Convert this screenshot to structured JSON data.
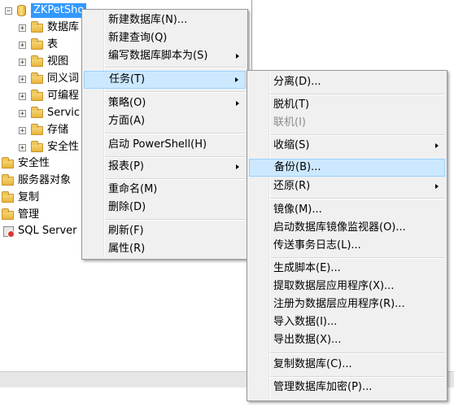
{
  "tree": {
    "root_label": "ZKPetSho",
    "children": [
      "数据库",
      "表",
      "视图",
      "同义词",
      "可编程",
      "Servic",
      "存储",
      "安全性"
    ],
    "top_level": [
      "安全性",
      "服务器对象",
      "复制",
      "管理",
      "SQL Server"
    ]
  },
  "context_menu": {
    "items": [
      {
        "label": "新建数据库(N)..."
      },
      {
        "label": "新建查询(Q)"
      },
      {
        "label": "编写数据库脚本为(S)"
      },
      {
        "label": "任务(T)"
      },
      {
        "label": "策略(O)"
      },
      {
        "label": "方面(A)"
      },
      {
        "label": "启动 PowerShell(H)"
      },
      {
        "label": "报表(P)"
      },
      {
        "label": "重命名(M)"
      },
      {
        "label": "删除(D)"
      },
      {
        "label": "刷新(F)"
      },
      {
        "label": "属性(R)"
      }
    ]
  },
  "tasks_submenu": {
    "items": [
      {
        "label": "分离(D)..."
      },
      {
        "label": "脱机(T)"
      },
      {
        "label": "联机(I)"
      },
      {
        "label": "收缩(S)"
      },
      {
        "label": "备份(B)..."
      },
      {
        "label": "还原(R)"
      },
      {
        "label": "镜像(M)..."
      },
      {
        "label": "启动数据库镜像监视器(O)..."
      },
      {
        "label": "传送事务日志(L)..."
      },
      {
        "label": "生成脚本(E)..."
      },
      {
        "label": "提取数据层应用程序(X)..."
      },
      {
        "label": "注册为数据层应用程序(R)..."
      },
      {
        "label": "导入数据(I)..."
      },
      {
        "label": "导出数据(X)..."
      },
      {
        "label": "复制数据库(C)..."
      },
      {
        "label": "管理数据库加密(P)..."
      }
    ]
  },
  "colors": {
    "selection": "#3399ff",
    "menu_background": "#f0f0f0",
    "menu_highlight": "#cce8ff"
  }
}
